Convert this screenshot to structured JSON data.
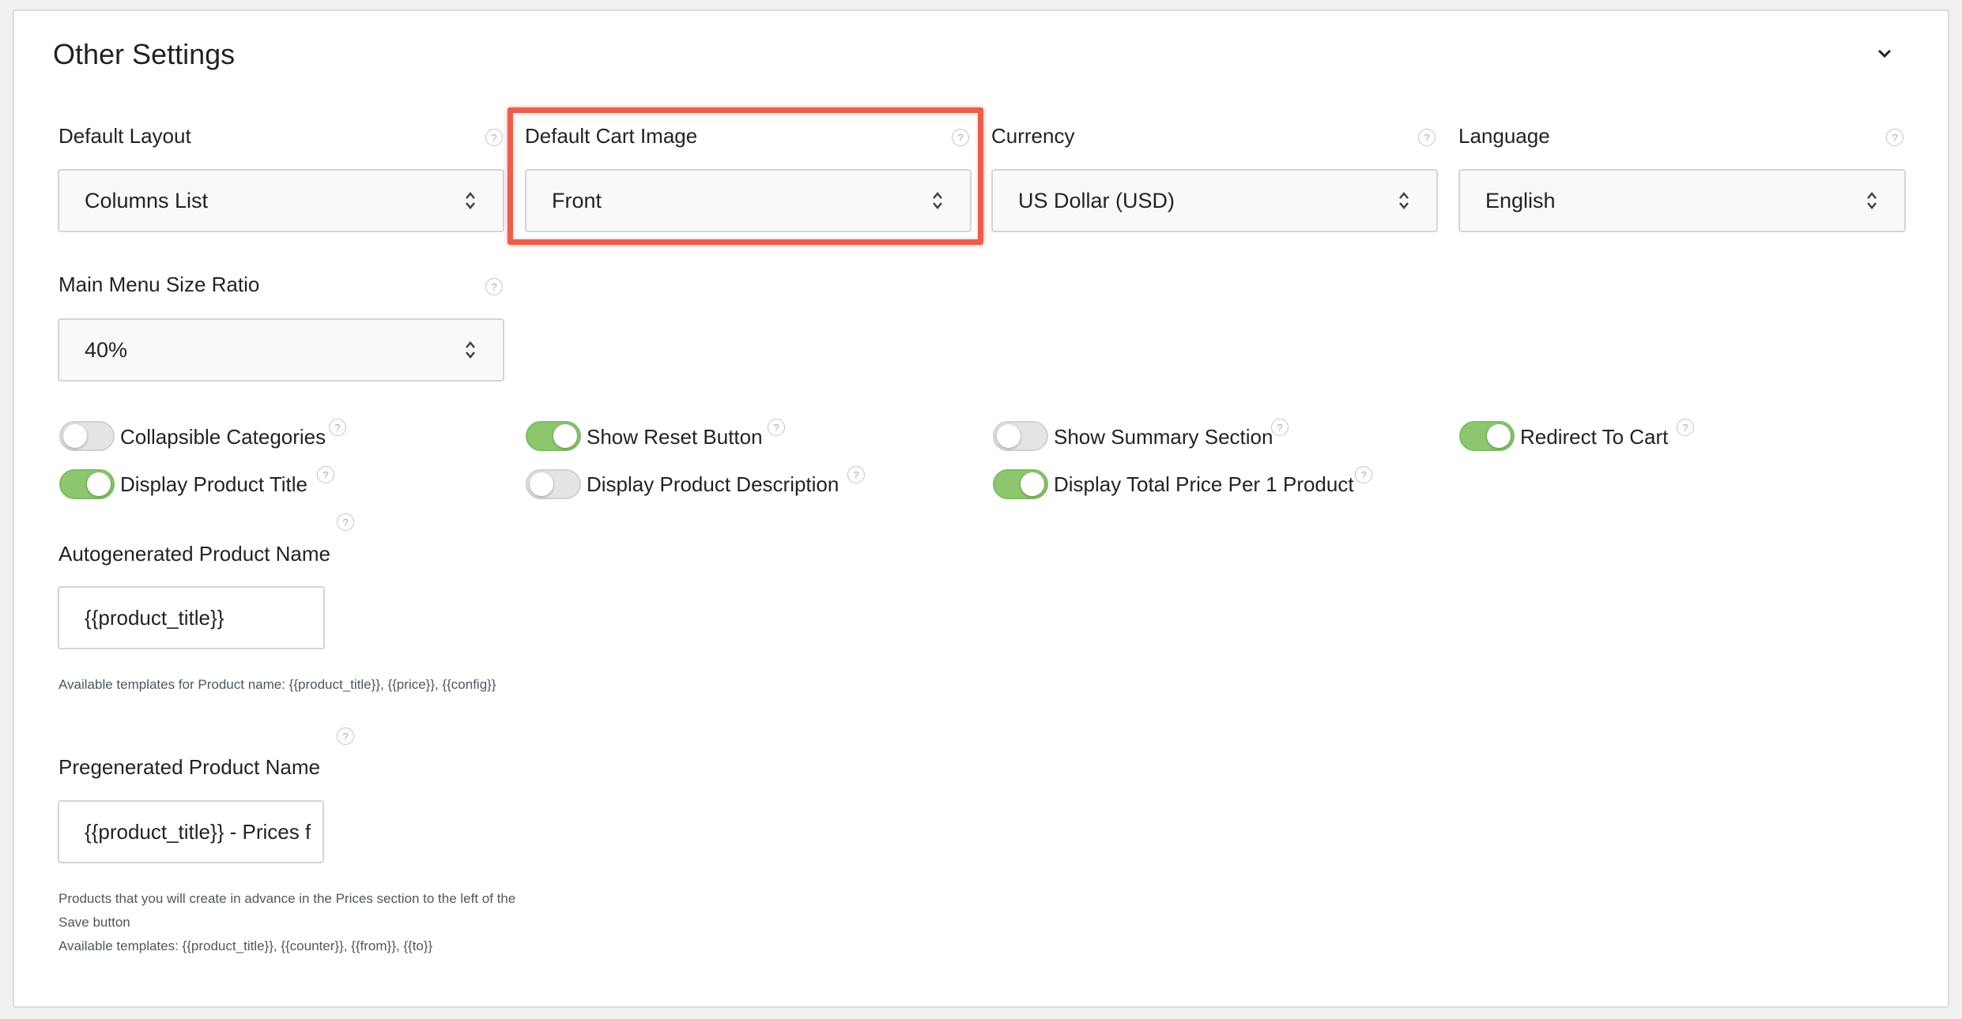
{
  "section": {
    "title": "Other Settings"
  },
  "icons": {
    "help": "?"
  },
  "selects": {
    "default_layout": {
      "label": "Default Layout",
      "value": "Columns List"
    },
    "default_cart_image": {
      "label": "Default Cart Image",
      "value": "Front"
    },
    "currency": {
      "label": "Currency",
      "value": "US Dollar (USD)"
    },
    "language": {
      "label": "Language",
      "value": "English"
    },
    "main_menu_size_ratio": {
      "label": "Main Menu Size Ratio",
      "value": "40%"
    }
  },
  "toggles": [
    {
      "label": "Collapsible Categories",
      "on": false
    },
    {
      "label": "Show Reset Button",
      "on": true
    },
    {
      "label": "Show Summary Section",
      "on": false
    },
    {
      "label": "Redirect To Cart",
      "on": true
    },
    {
      "label": "Display Product Title",
      "on": true
    },
    {
      "label": "Display Product Description",
      "on": false
    },
    {
      "label": "Display Total Price Per 1 Product",
      "on": true
    }
  ],
  "autogenerated": {
    "label": "Autogenerated Product Name",
    "value": "{{product_title}}",
    "hint": "Available templates for Product name: {{product_title}}, {{price}}, {{config}}"
  },
  "pregenerated": {
    "label": "Pregenerated Product Name",
    "value": "{{product_title}} - Prices f",
    "hint_lines": [
      "Products that you will create in advance in the Prices section to the left of the",
      "Save button",
      "Available templates: {{product_title}}, {{counter}}, {{from}}, {{to}}"
    ]
  },
  "colors": {
    "toggle_on": "#8cc770",
    "highlight": "#e8604c"
  }
}
